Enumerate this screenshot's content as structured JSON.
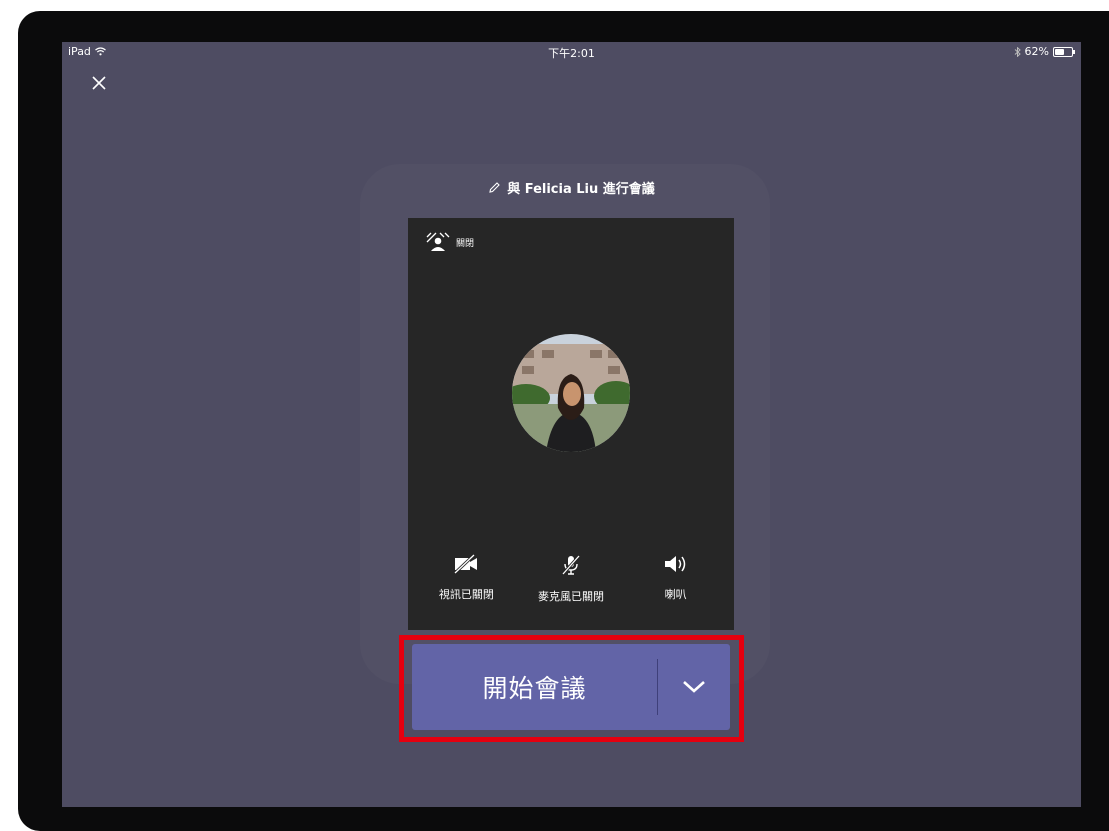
{
  "status_bar": {
    "device": "iPad",
    "time": "下午2:01",
    "battery": "62%",
    "battery_level": 0.62
  },
  "meeting": {
    "title": "與 Felicia Liu 進行會議"
  },
  "preview": {
    "background_toggle_label": "關閉",
    "controls": [
      {
        "label": "視訊已關閉",
        "icon": "camera-off-icon"
      },
      {
        "label": "麥克風已關閉",
        "icon": "mic-off-icon"
      },
      {
        "label": "喇叭",
        "icon": "speaker-icon"
      }
    ]
  },
  "join": {
    "label": "開始會議"
  },
  "colors": {
    "screen_bg": "#4e4c62",
    "preview_bg": "#262626",
    "accent": "#6264a7",
    "highlight": "#e5000f"
  }
}
